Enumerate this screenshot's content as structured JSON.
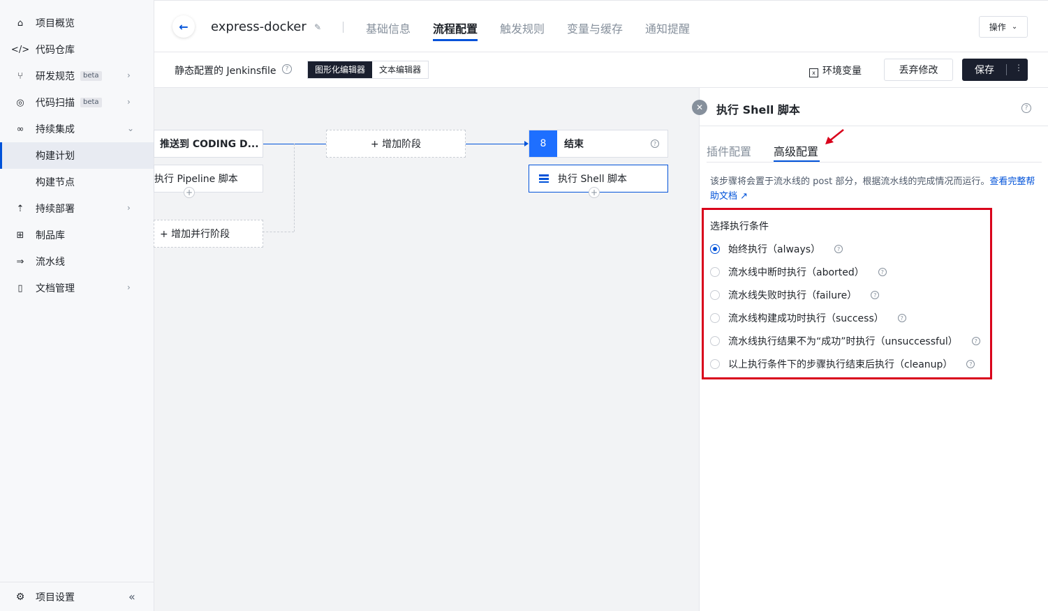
{
  "sidebar": {
    "items": [
      {
        "label": "项目概览",
        "icon": "home-icon"
      },
      {
        "label": "代码仓库",
        "icon": "code-icon"
      },
      {
        "label": "研发规范",
        "badge": "beta",
        "icon": "branch-icon"
      },
      {
        "label": "代码扫描",
        "badge": "beta",
        "icon": "scan-icon"
      },
      {
        "label": "持续集成",
        "icon": "infinity-icon"
      },
      {
        "label": "构建计划"
      },
      {
        "label": "构建节点"
      },
      {
        "label": "持续部署",
        "icon": "rocket-icon"
      },
      {
        "label": "制品库",
        "icon": "package-icon"
      },
      {
        "label": "流水线",
        "icon": "pipeline-icon"
      },
      {
        "label": "文档管理",
        "icon": "document-icon"
      }
    ],
    "settings": "项目设置"
  },
  "header": {
    "project": "express-docker",
    "tabs": [
      "基础信息",
      "流程配置",
      "触发规则",
      "变量与缓存",
      "通知提醒"
    ],
    "active_tab": "流程配置",
    "operation": "操作"
  },
  "toolbar": {
    "title": "静态配置的 Jenkinsfile",
    "editor_graphic": "图形化编辑器",
    "editor_text": "文本编辑器",
    "env": "环境变量",
    "discard": "丢弃修改",
    "save": "保存"
  },
  "canvas": {
    "stage_push": "推送到 CODING D...",
    "step_pipeline": "执行 Pipeline 脚本",
    "add_stage": "+ 增加阶段",
    "add_parallel": "+ 增加并行阶段",
    "end_num": "8",
    "end_label": "结束",
    "end_step": "执行 Shell 脚本"
  },
  "panel": {
    "title": "执行 Shell 脚本",
    "tab_plugin": "插件配置",
    "tab_advanced": "高级配置",
    "desc": "该步骤将会置于流水线的 post 部分，根据流水线的完成情况而运行。",
    "desc_link": "查看完整帮助文档",
    "cond_title": "选择执行条件",
    "conditions": [
      {
        "label": "始终执行（always）",
        "checked": true
      },
      {
        "label": "流水线中断时执行（aborted）",
        "checked": false
      },
      {
        "label": "流水线失败时执行（failure）",
        "checked": false
      },
      {
        "label": "流水线构建成功时执行（success）",
        "checked": false
      },
      {
        "label": "流水线执行结果不为“成功”时执行（unsuccessful）",
        "checked": false
      },
      {
        "label": "以上执行条件下的步骤执行结束后执行（cleanup）",
        "checked": false
      }
    ]
  },
  "colors": {
    "accent": "#0052d9",
    "highlight": "#d9001b",
    "dark": "#1a1f2e"
  }
}
